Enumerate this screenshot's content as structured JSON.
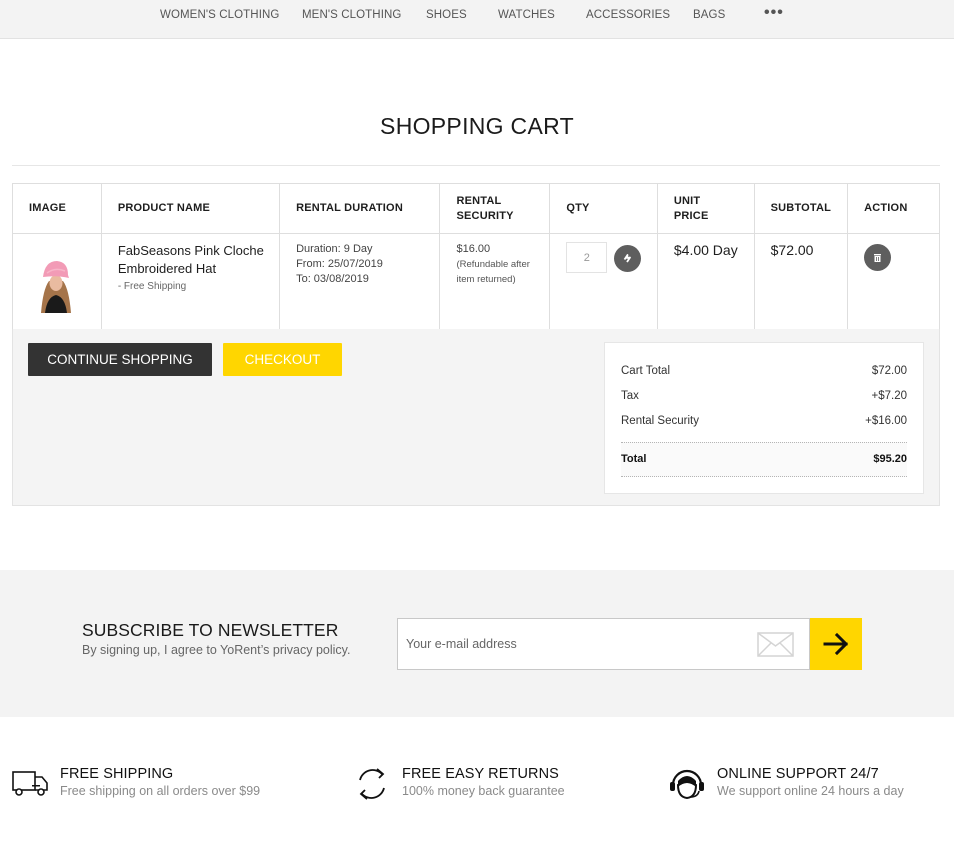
{
  "nav": {
    "items": [
      {
        "label": "WOMEN'S CLOTHING"
      },
      {
        "label": "MEN'S CLOTHING"
      },
      {
        "label": "SHOES"
      },
      {
        "label": "WATCHES"
      },
      {
        "label": "ACCESSORIES"
      },
      {
        "label": "BAGS"
      }
    ],
    "more_label": "•••"
  },
  "page": {
    "title": "SHOPPING CART"
  },
  "cart": {
    "headers": {
      "image": "IMAGE",
      "product_name": "PRODUCT NAME",
      "rental_duration": "RENTAL DURATION",
      "rental_security_line1": "RENTAL",
      "rental_security_line2": "SECURITY",
      "qty": "QTY",
      "unit_price": "UNIT PRICE",
      "subtotal": "SUBTOTAL",
      "action": "ACTION"
    },
    "items": [
      {
        "name": "FabSeasons Pink Cloche Embroidered Hat",
        "shipping_note": "- Free Shipping",
        "duration": "Duration: 9 Day",
        "from": "From: 25/07/2019",
        "to": "To: 03/08/2019",
        "security_amount": "$16.00",
        "security_note": "(Refundable after item returned)",
        "qty": "2",
        "unit_price": "$4.00 Day",
        "subtotal": "$72.00",
        "image_icon": "product-thumbnail-pink-hat"
      }
    ],
    "buttons": {
      "continue": "CONTINUE SHOPPING",
      "checkout": "CHECKOUT"
    }
  },
  "totals": {
    "cart_total_label": "Cart Total",
    "cart_total_value": "$72.00",
    "tax_label": "Tax",
    "tax_value": "+$7.20",
    "security_label": "Rental Security",
    "security_value": "+$16.00",
    "total_label": "Total",
    "total_value": "$95.20"
  },
  "newsletter": {
    "title": "SUBSCRIBE TO NEWSLETTER",
    "subtitle": "By signing up, I agree to YoRent’s privacy policy.",
    "input_placeholder": "Your e-mail address",
    "input_value": "",
    "accent_color": "#ffd600"
  },
  "features": [
    {
      "icon": "truck-icon",
      "title": "FREE SHIPPING",
      "subtitle": "Free shipping on all orders over $99"
    },
    {
      "icon": "refresh-icon",
      "title": "FREE EASY RETURNS",
      "subtitle": "100% money back guarantee"
    },
    {
      "icon": "headset-icon",
      "title": "ONLINE SUPPORT 24/7",
      "subtitle": "We support online 24 hours a day"
    }
  ],
  "colors": {
    "accent": "#ffd600",
    "dark_button": "#333333",
    "icon_button": "#5e5e5e"
  }
}
